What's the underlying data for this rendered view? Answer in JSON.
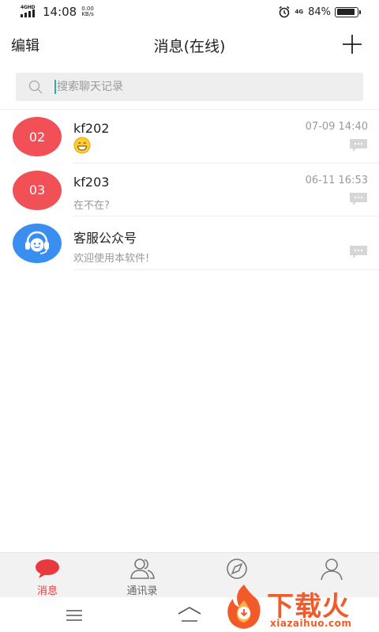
{
  "status_bar": {
    "network_left": "4GHD",
    "time": "14:08",
    "speed_value": "0.00",
    "speed_unit": "KB/s",
    "network_right": "4G",
    "battery_percent": "84%",
    "battery_level": 0.84
  },
  "header": {
    "edit_label": "编辑",
    "title": "消息(在线)"
  },
  "search": {
    "placeholder": "搜索聊天记录"
  },
  "chats": [
    {
      "avatar_text": "02",
      "avatar_color": "#f15056",
      "name": "kf202",
      "time": "07-09 14:40",
      "preview": "",
      "preview_icon": "grinning-emoji-icon"
    },
    {
      "avatar_text": "03",
      "avatar_color": "#f15056",
      "name": "kf203",
      "time": "06-11 16:53",
      "preview": "在不在?"
    },
    {
      "avatar_text": "",
      "avatar_color": "#3a8ef0",
      "avatar_icon": "customer-service-headset-icon",
      "name": "客服公众号",
      "time": "",
      "preview": "欢迎使用本软件!"
    }
  ],
  "tabs": [
    {
      "label": "消息",
      "icon": "message-bubble-icon",
      "active": true
    },
    {
      "label": "通讯录",
      "icon": "contacts-icon",
      "active": false
    },
    {
      "label": "",
      "icon": "compass-icon",
      "active": false
    },
    {
      "label": "",
      "icon": "profile-icon",
      "active": false
    }
  ],
  "watermark": {
    "text": "下载火",
    "domain": "xiazaihuo.com"
  },
  "colors": {
    "accent_red": "#e8393f",
    "avatar_red": "#f15056",
    "avatar_blue": "#3a8ef0",
    "watermark_orange": "#f25a2a"
  }
}
